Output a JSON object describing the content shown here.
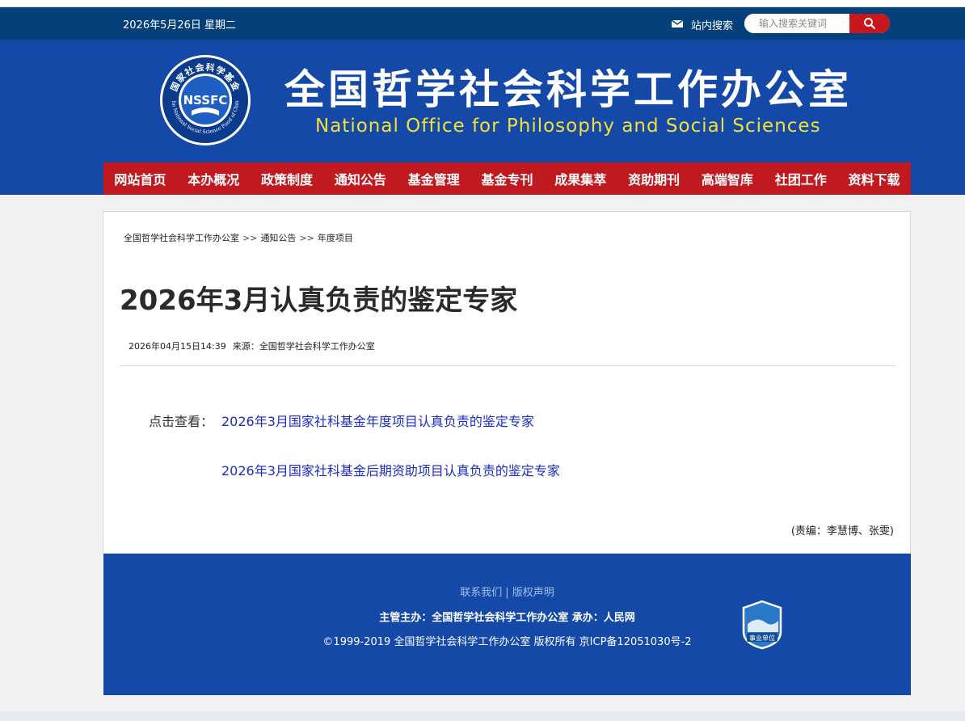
{
  "topbar": {
    "date": "2026年5月26日 星期二",
    "search_label": "站内搜索",
    "search_placeholder": "输入搜索关键词",
    "mail_icon": "mail-icon",
    "search_icon": "search-icon"
  },
  "header": {
    "title_cn": "全国哲学社会科学工作办公室",
    "title_en": "National Office for Philosophy and Social Sciences",
    "logo": {
      "ring_top_text": "国家社会科学基金",
      "center_text": "NSSFC",
      "ring_bottom_text": "The National Social Science Fund of China"
    }
  },
  "nav": {
    "items": [
      "网站首页",
      "本办概况",
      "政策制度",
      "通知公告",
      "基金管理",
      "基金专刊",
      "成果集萃",
      "资助期刊",
      "高端智库",
      "社团工作",
      "资料下载"
    ]
  },
  "breadcrumb": {
    "items": [
      "全国哲学社会科学工作办公室",
      "通知公告",
      "年度项目"
    ],
    "separator": ">>"
  },
  "article": {
    "title": "2026年3月认真负责的鉴定专家",
    "datetime": "2026年04月15日14:39",
    "source": "来源：全国哲学社会科学工作办公室",
    "click_label": "点击查看：",
    "links": [
      "2026年3月国家社科基金年度项目认真负责的鉴定专家",
      "2026年3月国家社科基金后期资助项目认真负责的鉴定专家"
    ],
    "editor": "(责编：李慧博、张雯)"
  },
  "footer": {
    "contact": "联系我们",
    "link_separator": "|",
    "copyright_notice": "版权声明",
    "sponsor": "主管主办：全国哲学社会科学工作办公室 承办：人民网",
    "copyright": "©1999-2019 全国哲学社会科学工作办公室 版权所有 京ICP备12051030号-2",
    "badge_text": "事业单位"
  },
  "colors": {
    "topbar": "#06407a",
    "banner": "#1549a8",
    "nav": "#c01920",
    "link": "#1a2dbf",
    "title_en": "#f3e037"
  }
}
